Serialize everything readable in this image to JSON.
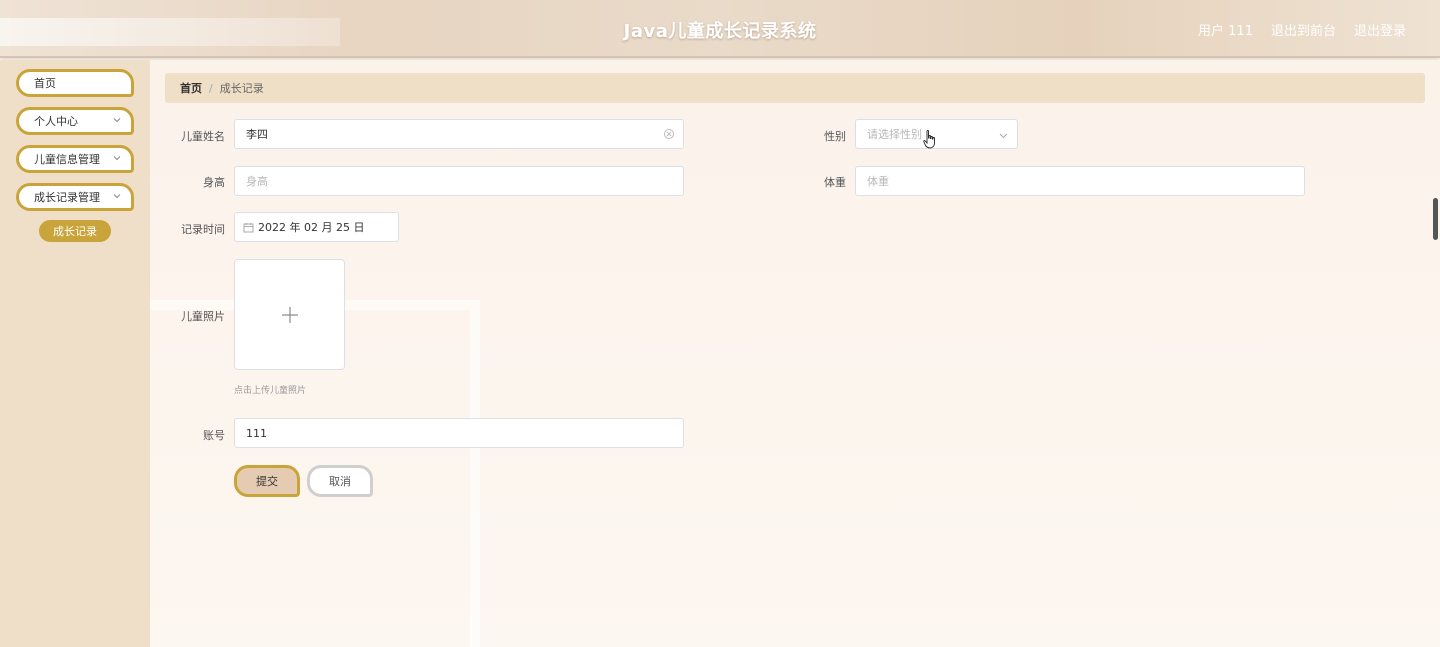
{
  "header": {
    "title": "Java儿童成长记录系统",
    "user": "用户 111",
    "front_link": "退出到前台",
    "logout": "退出登录"
  },
  "sidebar": {
    "items": [
      {
        "label": "首页",
        "has_chevron": false
      },
      {
        "label": "个人中心",
        "has_chevron": true
      },
      {
        "label": "儿童信息管理",
        "has_chevron": true
      },
      {
        "label": "成长记录管理",
        "has_chevron": true
      }
    ],
    "sub_item": "成长记录"
  },
  "breadcrumb": {
    "home": "首页",
    "separator": "/",
    "current": "成长记录"
  },
  "form": {
    "name_label": "儿童姓名",
    "name_value": "李四",
    "gender_label": "性别",
    "gender_placeholder": "请选择性别",
    "height_label": "身高",
    "height_placeholder": "身高",
    "weight_label": "体重",
    "weight_placeholder": "体重",
    "date_label": "记录时间",
    "date_value": "2022 年 02 月 25 日",
    "photo_label": "儿童照片",
    "photo_tip": "点击上传儿童照片",
    "account_label": "账号",
    "account_value": "111",
    "submit": "提交",
    "cancel": "取消"
  },
  "colors": {
    "accent": "#c9a43a",
    "sidebar_bg": "#f0dfc8",
    "breadcrumb_bg": "#efdfc7"
  }
}
